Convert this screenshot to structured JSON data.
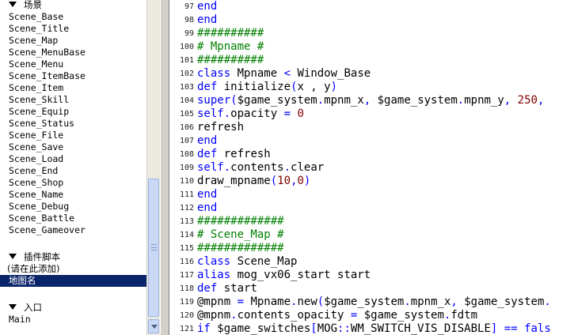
{
  "tree": {
    "groups": [
      {
        "label": "场景",
        "items": [
          "Scene_Base",
          "Scene_Title",
          "Scene_Map",
          "Scene_MenuBase",
          "Scene_Menu",
          "Scene_ItemBase",
          "Scene_Item",
          "Scene_Skill",
          "Scene_Equip",
          "Scene_Status",
          "Scene_File",
          "Scene_Save",
          "Scene_Load",
          "Scene_End",
          "Scene_Shop",
          "Scene_Name",
          "Scene_Debug",
          "Scene_Battle",
          "Scene_Gameover"
        ]
      },
      {
        "label": "插件脚本",
        "items": [
          "(请在此添加)",
          "地图名"
        ]
      },
      {
        "label": "入口",
        "items": [
          "Main"
        ]
      }
    ],
    "selected": "地图名"
  },
  "code": {
    "lines": [
      {
        "n": "97",
        "tokens": [
          [
            "kw",
            "end"
          ]
        ]
      },
      {
        "n": "98",
        "tokens": [
          [
            "kw",
            "end"
          ]
        ]
      },
      {
        "n": "99",
        "tokens": [
          [
            "cm",
            "##########"
          ]
        ]
      },
      {
        "n": "100",
        "tokens": [
          [
            "cm",
            "# Mpname #"
          ]
        ]
      },
      {
        "n": "101",
        "tokens": [
          [
            "cm",
            "##########"
          ]
        ]
      },
      {
        "n": "102",
        "tokens": [
          [
            "kw",
            "class"
          ],
          [
            "sym",
            " Mpname "
          ],
          [
            "kw",
            "<"
          ],
          [
            "sym",
            " Window_Base"
          ]
        ]
      },
      {
        "n": "103",
        "tokens": [
          [
            "kw",
            "def"
          ],
          [
            "sym",
            " initialize"
          ],
          [
            "kw",
            "("
          ],
          [
            "sym",
            "x , y"
          ],
          [
            "kw",
            ")"
          ]
        ]
      },
      {
        "n": "104",
        "tokens": [
          [
            "kw",
            "super"
          ],
          [
            "kw",
            "("
          ],
          [
            "sym",
            "$game_system"
          ],
          [
            "kw",
            "."
          ],
          [
            "sym",
            "mpnm_x"
          ],
          [
            "kw",
            ","
          ],
          [
            "sym",
            " $game_system"
          ],
          [
            "kw",
            "."
          ],
          [
            "sym",
            "mpnm_y"
          ],
          [
            "kw",
            ","
          ],
          [
            "sym",
            " "
          ],
          [
            "nm",
            "250"
          ],
          [
            "kw",
            ","
          ]
        ]
      },
      {
        "n": "105",
        "tokens": [
          [
            "kw",
            "self"
          ],
          [
            "kw",
            "."
          ],
          [
            "sym",
            "opacity "
          ],
          [
            "kw",
            "="
          ],
          [
            "sym",
            " "
          ],
          [
            "nm",
            "0"
          ]
        ]
      },
      {
        "n": "106",
        "tokens": [
          [
            "sym",
            "refresh"
          ]
        ]
      },
      {
        "n": "107",
        "tokens": [
          [
            "kw",
            "end"
          ]
        ]
      },
      {
        "n": "108",
        "tokens": [
          [
            "kw",
            "def"
          ],
          [
            "sym",
            " refresh"
          ]
        ]
      },
      {
        "n": "109",
        "tokens": [
          [
            "kw",
            "self"
          ],
          [
            "kw",
            "."
          ],
          [
            "sym",
            "contents"
          ],
          [
            "kw",
            "."
          ],
          [
            "sym",
            "clear"
          ]
        ]
      },
      {
        "n": "110",
        "tokens": [
          [
            "sym",
            "draw_mpname"
          ],
          [
            "kw",
            "("
          ],
          [
            "nm",
            "10"
          ],
          [
            "kw",
            ","
          ],
          [
            "nm",
            "0"
          ],
          [
            "kw",
            ")"
          ]
        ]
      },
      {
        "n": "111",
        "tokens": [
          [
            "kw",
            "end"
          ]
        ]
      },
      {
        "n": "112",
        "tokens": [
          [
            "kw",
            "end"
          ]
        ]
      },
      {
        "n": "113",
        "tokens": [
          [
            "cm",
            "#############"
          ]
        ]
      },
      {
        "n": "114",
        "tokens": [
          [
            "cm",
            "# Scene_Map #"
          ]
        ]
      },
      {
        "n": "115",
        "tokens": [
          [
            "cm",
            "#############"
          ]
        ]
      },
      {
        "n": "116",
        "tokens": [
          [
            "kw",
            "class"
          ],
          [
            "sym",
            " Scene_Map"
          ]
        ]
      },
      {
        "n": "117",
        "tokens": [
          [
            "kw",
            "alias"
          ],
          [
            "sym",
            " mog_vx06_start start"
          ]
        ]
      },
      {
        "n": "118",
        "tokens": [
          [
            "kw",
            "def"
          ],
          [
            "sym",
            " start"
          ]
        ]
      },
      {
        "n": "119",
        "tokens": [
          [
            "sym",
            "@mpnm "
          ],
          [
            "kw",
            "="
          ],
          [
            "sym",
            " Mpname"
          ],
          [
            "kw",
            "."
          ],
          [
            "sym",
            "new"
          ],
          [
            "kw",
            "("
          ],
          [
            "sym",
            "$game_system"
          ],
          [
            "kw",
            "."
          ],
          [
            "sym",
            "mpnm_x"
          ],
          [
            "kw",
            ","
          ],
          [
            "sym",
            " $game_system"
          ],
          [
            "kw",
            "."
          ]
        ]
      },
      {
        "n": "120",
        "tokens": [
          [
            "sym",
            "@mpnm"
          ],
          [
            "kw",
            "."
          ],
          [
            "sym",
            "contents_opacity "
          ],
          [
            "kw",
            "="
          ],
          [
            "sym",
            " $game_system"
          ],
          [
            "kw",
            "."
          ],
          [
            "sym",
            "fdtm"
          ]
        ]
      },
      {
        "n": "121",
        "tokens": [
          [
            "kw",
            "if"
          ],
          [
            "sym",
            " $game_switches"
          ],
          [
            "kw",
            "["
          ],
          [
            "sym",
            "MOG"
          ],
          [
            "kw",
            "::"
          ],
          [
            "sym",
            "WM_SWITCH_VIS_DISABLE"
          ],
          [
            "kw",
            "]"
          ],
          [
            "sym",
            " "
          ],
          [
            "kw",
            "=="
          ],
          [
            "sym",
            " "
          ],
          [
            "kw",
            "fals"
          ]
        ]
      }
    ]
  }
}
